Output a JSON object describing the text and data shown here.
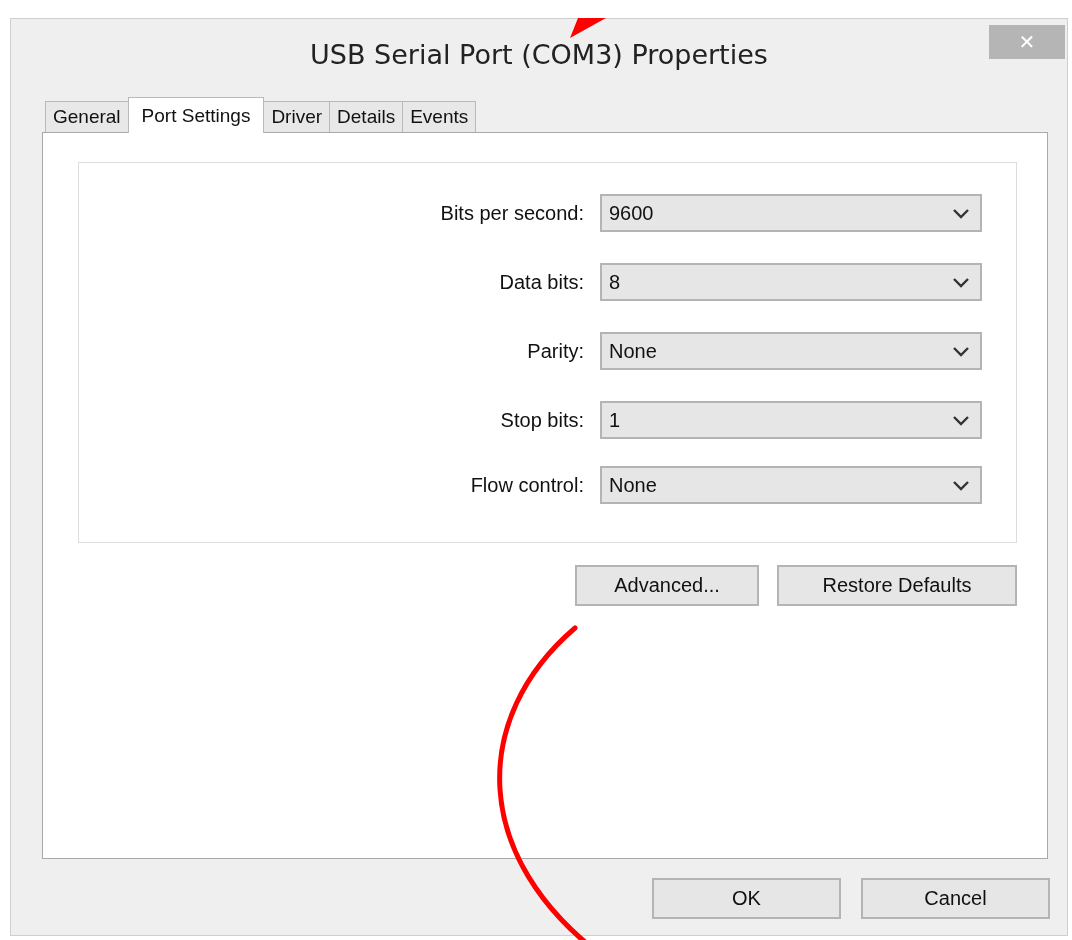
{
  "window": {
    "title": "USB Serial Port (COM3) Properties",
    "close": "✕"
  },
  "tabs": [
    {
      "label": "General",
      "selected": false
    },
    {
      "label": "Port Settings",
      "selected": true
    },
    {
      "label": "Driver",
      "selected": false
    },
    {
      "label": "Details",
      "selected": false
    },
    {
      "label": "Events",
      "selected": false
    }
  ],
  "settings": [
    {
      "label": "Bits per second:",
      "value": "9600"
    },
    {
      "label": "Data bits:",
      "value": "8"
    },
    {
      "label": "Parity:",
      "value": "None"
    },
    {
      "label": "Stop bits:",
      "value": "1"
    },
    {
      "label": "Flow control:",
      "value": "None"
    }
  ],
  "panel_buttons": [
    "Advanced...",
    "Restore Defaults"
  ],
  "dialog_buttons": [
    "OK",
    "Cancel"
  ],
  "annotations": {
    "arrow_tip": true,
    "curve": true
  }
}
